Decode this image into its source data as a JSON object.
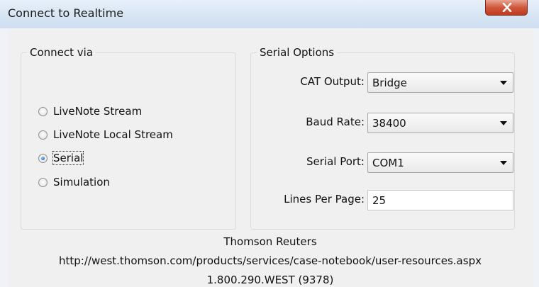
{
  "window": {
    "title": "Connect to Realtime"
  },
  "connect_via": {
    "legend": "Connect via",
    "options": [
      {
        "label": "LiveNote Stream",
        "checked": false
      },
      {
        "label": "LiveNote Local Stream",
        "checked": false
      },
      {
        "label": "Serial",
        "checked": true
      },
      {
        "label": "Simulation",
        "checked": false
      }
    ]
  },
  "serial_options": {
    "legend": "Serial Options",
    "cat_output": {
      "label": "CAT Output:",
      "value": "Bridge"
    },
    "baud_rate": {
      "label": "Baud Rate:",
      "value": "38400"
    },
    "serial_port": {
      "label": "Serial Port:",
      "value": "COM1"
    },
    "lines_per_page": {
      "label": "Lines Per Page:",
      "value": "25"
    }
  },
  "footer": {
    "company": "Thomson Reuters",
    "url": "http://west.thomson.com/products/services/case-notebook/user-resources.aspx",
    "phone": "1.800.290.WEST (9378)"
  },
  "colors": {
    "close_button": "#c9472c",
    "radio_selected": "#1c6fc7"
  }
}
